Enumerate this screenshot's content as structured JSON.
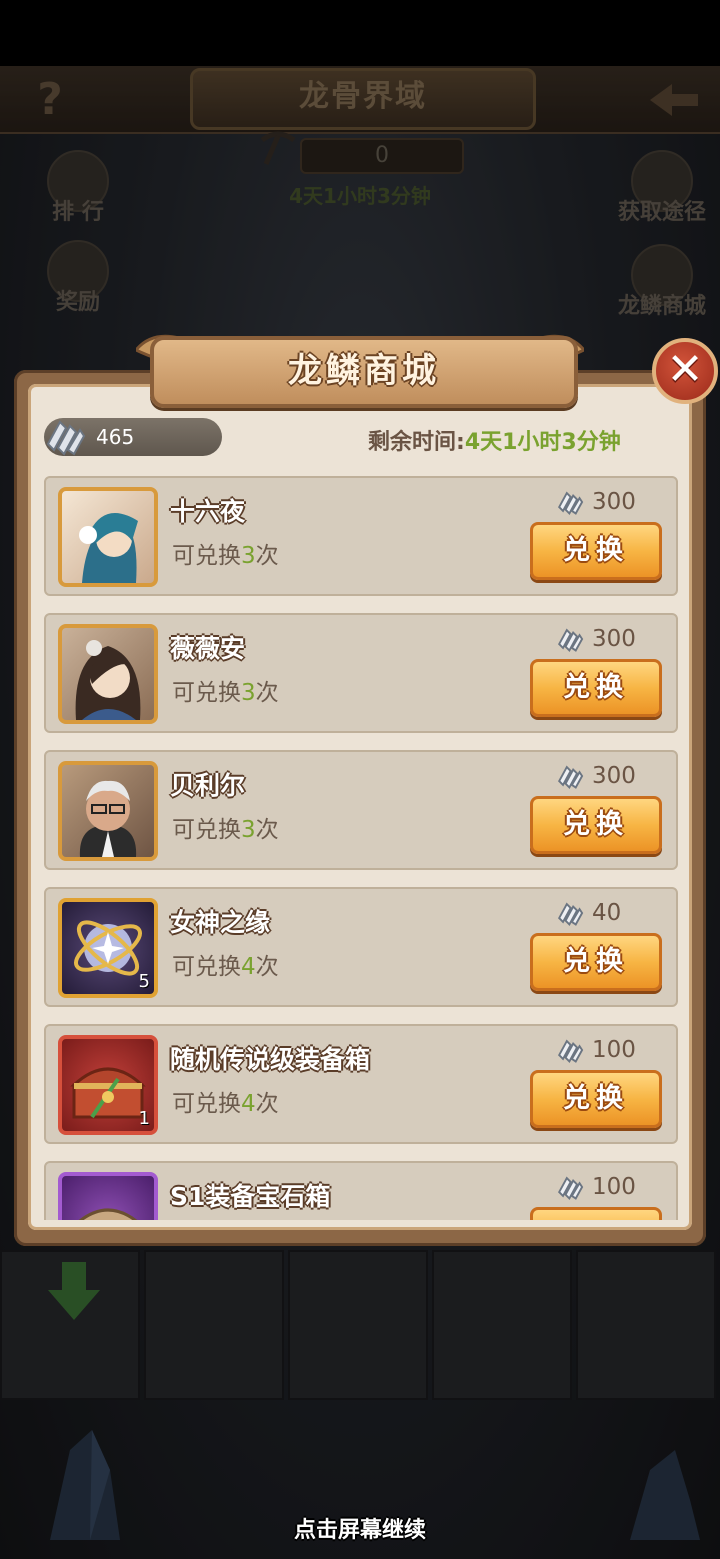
{
  "header": {
    "title": "龙骨界域",
    "counter": "0",
    "countdown": "4天1小时3分钟"
  },
  "side_buttons": {
    "rank": "排 行",
    "reward": "奖励",
    "obtain": "获取途径",
    "shop": "龙鳞商城"
  },
  "modal": {
    "title": "龙鳞商城",
    "currency": "465",
    "remaining_label": "剩余时间:",
    "remaining_time": "4天1小时3分钟",
    "items": [
      {
        "name": "十六夜",
        "limit_prefix": "可兑换",
        "limit_count": "3",
        "limit_suffix": "次",
        "price": "300",
        "button": "兑换",
        "qty": ""
      },
      {
        "name": "薇薇安",
        "limit_prefix": "可兑换",
        "limit_count": "3",
        "limit_suffix": "次",
        "price": "300",
        "button": "兑换",
        "qty": ""
      },
      {
        "name": "贝利尔",
        "limit_prefix": "可兑换",
        "limit_count": "3",
        "limit_suffix": "次",
        "price": "300",
        "button": "兑换",
        "qty": ""
      },
      {
        "name": "女神之缘",
        "limit_prefix": "可兑换",
        "limit_count": "4",
        "limit_suffix": "次",
        "price": "40",
        "button": "兑换",
        "qty": "5"
      },
      {
        "name": "随机传说级装备箱",
        "limit_prefix": "可兑换",
        "limit_count": "4",
        "limit_suffix": "次",
        "price": "100",
        "button": "兑换",
        "qty": "1"
      },
      {
        "name": "S1装备宝石箱",
        "limit_prefix": "",
        "limit_count": "",
        "limit_suffix": "",
        "price": "100",
        "button": "",
        "qty": ""
      }
    ]
  },
  "footer": {
    "continue_hint": "点击屏幕继续"
  },
  "colors": {
    "accent_green": "#7aa22f",
    "button_orange": "#f7b544",
    "panel_bg": "#ece3d6"
  }
}
